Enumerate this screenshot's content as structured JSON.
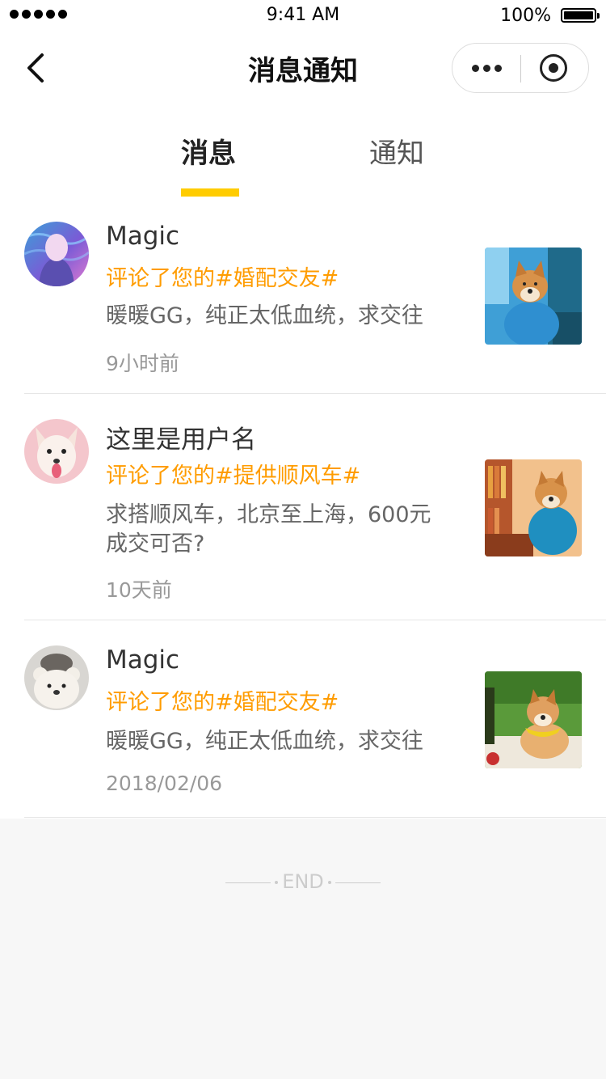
{
  "status_bar": {
    "time": "9:41 AM",
    "battery": "100%"
  },
  "nav": {
    "title": "消息通知"
  },
  "tabs": [
    {
      "label": "消息",
      "active": true
    },
    {
      "label": "通知",
      "active": false
    }
  ],
  "accent_color": "#ffcc00",
  "highlight_color": "#ff9c00",
  "messages": [
    {
      "username": "Magic",
      "action": "评论了您的#婚配交友#",
      "content": "暖暖GG，纯正太低血统，求交往",
      "time": "9小时前"
    },
    {
      "username": "这里是用户名",
      "action": "评论了您的#提供顺风车#",
      "content": "求搭顺风车，北京至上海，600元成交可否?",
      "time": "10天前"
    },
    {
      "username": "Magic",
      "action": "评论了您的#婚配交友#",
      "content": "暖暖GG，纯正太低血统，求交往",
      "time": "2018/02/06"
    }
  ],
  "end_text": "END"
}
